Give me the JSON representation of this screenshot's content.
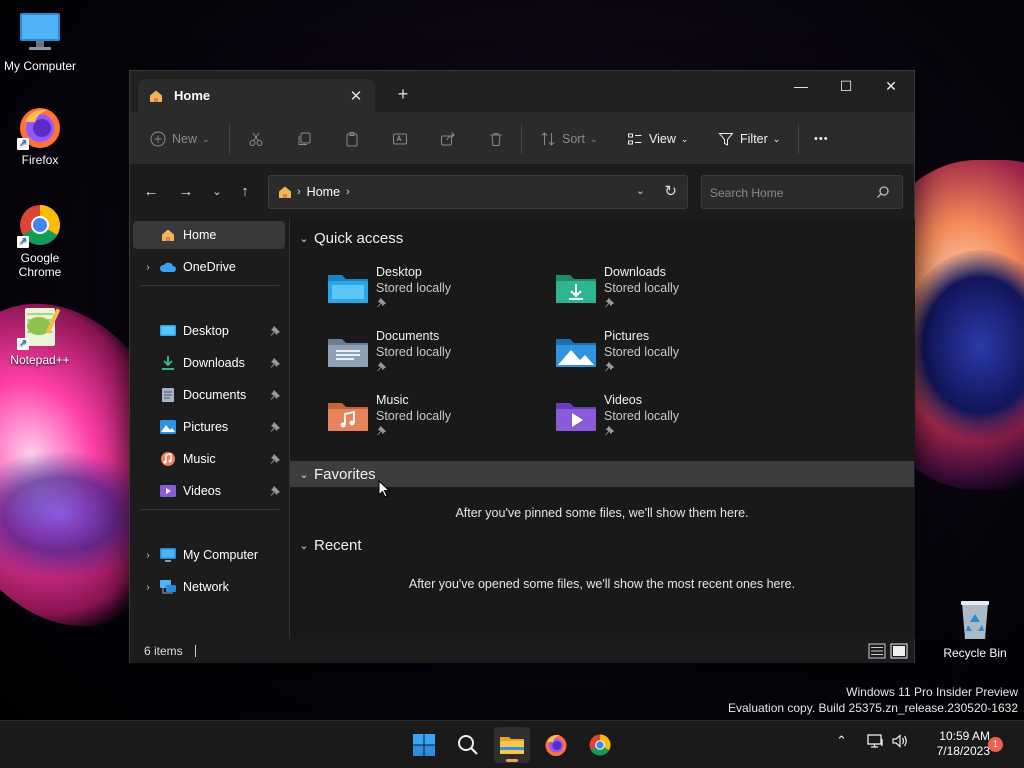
{
  "desktop": {
    "icons": [
      {
        "label": "My Computer"
      },
      {
        "label": "Firefox"
      },
      {
        "label": "Google Chrome"
      },
      {
        "label": "Notepad++"
      },
      {
        "label": "Recycle Bin"
      }
    ],
    "watermark_line1": "Windows 11 Pro Insider Preview",
    "watermark_line2": "Evaluation copy. Build 25375.zn_release.230520-1632"
  },
  "window": {
    "tab_title": "Home",
    "tab_close": "✕",
    "new_tab": "+",
    "minimize": "—",
    "maximize": "☐",
    "close": "✕"
  },
  "toolbar": {
    "new_label": "New",
    "sort_label": "Sort",
    "view_label": "View",
    "filter_label": "Filter",
    "more_label": "•••"
  },
  "address": {
    "crumb": "Home",
    "search_placeholder": "Search Home"
  },
  "nav": {
    "items": [
      {
        "label": "Home"
      },
      {
        "label": "OneDrive"
      },
      {
        "label": "Desktop"
      },
      {
        "label": "Downloads"
      },
      {
        "label": "Documents"
      },
      {
        "label": "Pictures"
      },
      {
        "label": "Music"
      },
      {
        "label": "Videos"
      },
      {
        "label": "My Computer"
      },
      {
        "label": "Network"
      }
    ]
  },
  "content": {
    "quick_access_title": "Quick access",
    "quick_access": [
      {
        "name": "Desktop",
        "sub": "Stored locally",
        "color": "#2aa7e8"
      },
      {
        "name": "Downloads",
        "sub": "Stored locally",
        "color": "#2fb58f"
      },
      {
        "name": "Documents",
        "sub": "Stored locally",
        "color": "#8ea1b8"
      },
      {
        "name": "Pictures",
        "sub": "Stored locally",
        "color": "#2f93e0"
      },
      {
        "name": "Music",
        "sub": "Stored locally",
        "color": "#e8845c"
      },
      {
        "name": "Videos",
        "sub": "Stored locally",
        "color": "#8a5bd8"
      }
    ],
    "favorites_title": "Favorites",
    "favorites_empty": "After you've pinned some files, we'll show them here.",
    "recent_title": "Recent",
    "recent_empty": "After you've opened some files, we'll show the most recent ones here."
  },
  "status": {
    "item_count": "6 items"
  },
  "taskbar": {
    "time": "10:59 AM",
    "date": "7/18/2023",
    "notification_count": "1"
  },
  "colors": {
    "accent": "#f0a060",
    "window_bg": "#1c1c1c",
    "toolbar_bg": "#2b2b2b"
  }
}
